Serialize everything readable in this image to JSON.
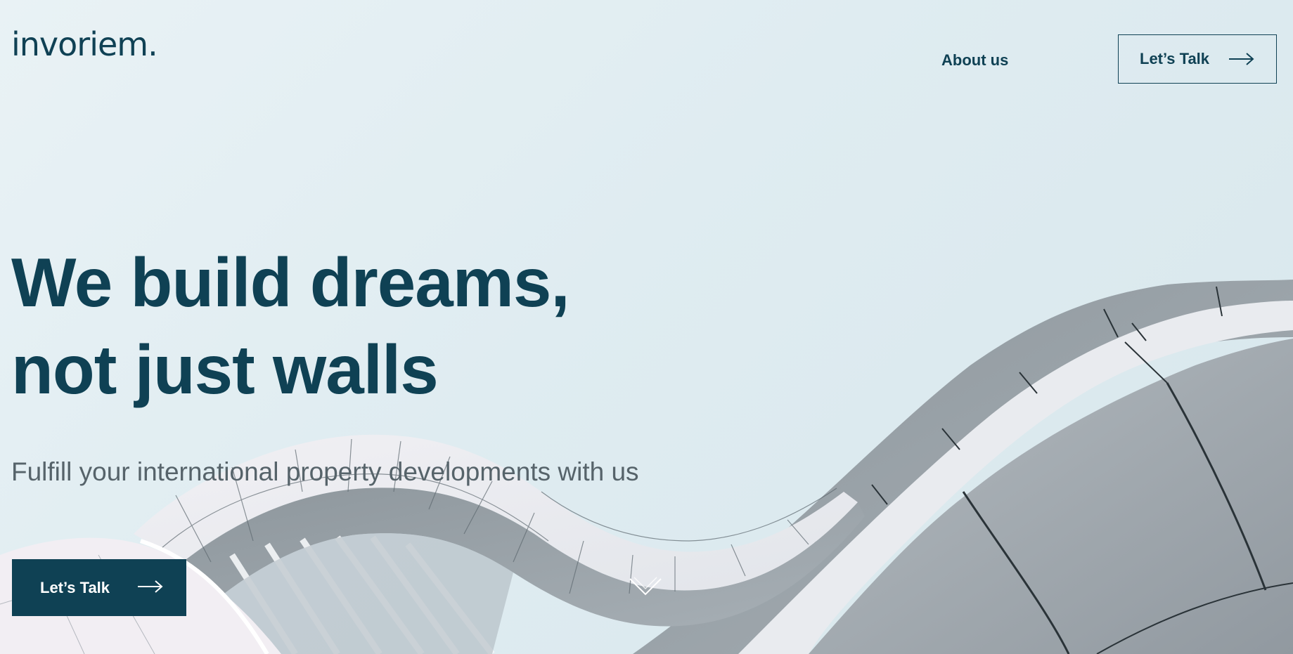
{
  "header": {
    "logo_text": "invoriem.",
    "nav": [
      {
        "label": "About us"
      }
    ],
    "cta_label": "Let’s Talk"
  },
  "hero": {
    "title_line1": "We build dreams,",
    "title_line2": "not just walls",
    "subtitle": "Fulfill your international property developments with us",
    "cta_label": "Let’s Talk"
  },
  "icons": {
    "cta_arrow": "arrow-right-icon",
    "scroll": "chevron-down-icon"
  },
  "colors": {
    "brand": "#0f4154",
    "background": "#e3eef2",
    "subtitle_text": "#56636a",
    "building": "#9aa4ab"
  }
}
